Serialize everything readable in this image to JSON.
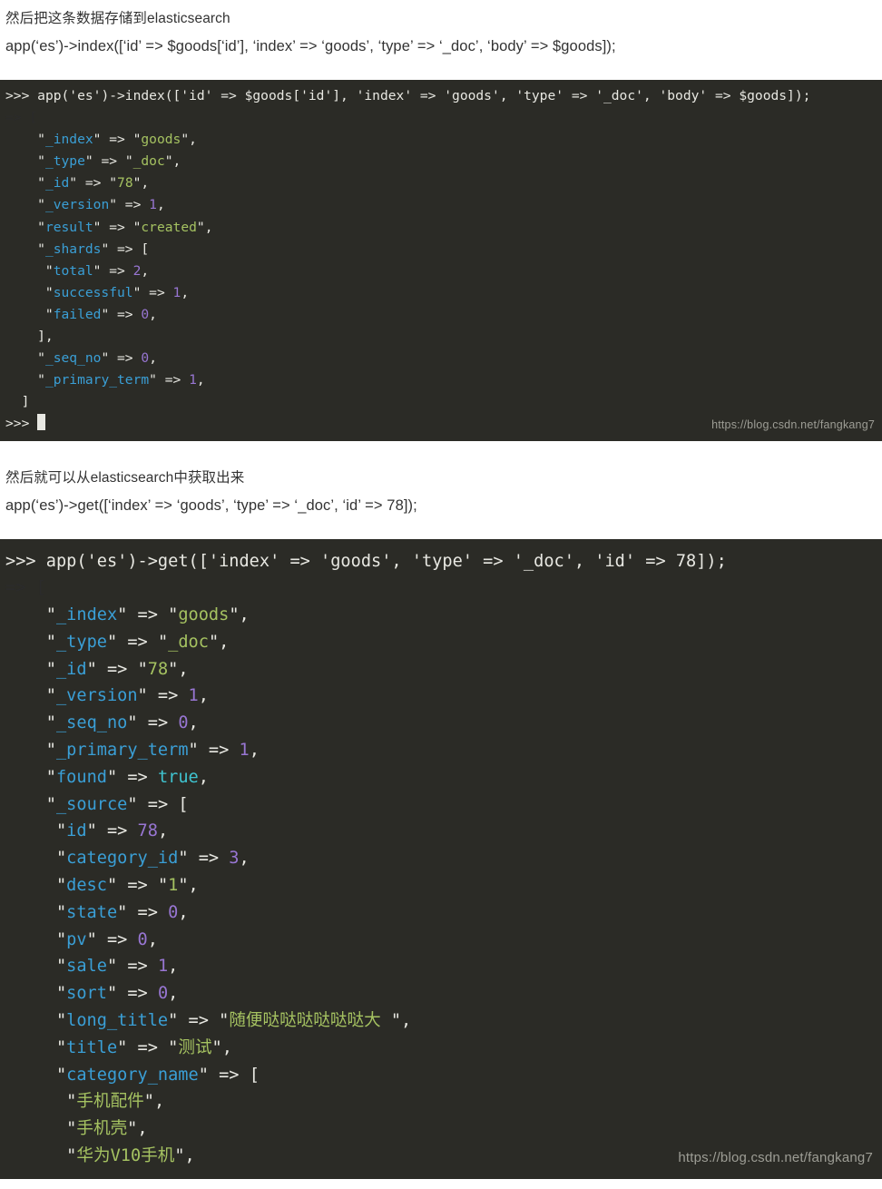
{
  "page": {
    "background": "#ffffff",
    "terminal_background": "#2b2b26"
  },
  "colors": {
    "key": "#3a9fd6",
    "string": "#a5c261",
    "number": "#9876d3",
    "boolean": "#3fc4d0",
    "plain": "#e8e8e2",
    "watermark": "#9d9d95"
  },
  "intro_section": {
    "note": "然后把这条数据存储到elasticsearch",
    "code": "app(‘es’)->index([‘id’ => $goods[‘id’], ‘index’ => ‘goods’, ‘type’ => ‘_doc’, ‘body’ => $goods]);"
  },
  "terminal_one": {
    "watermark": "https://blog.csdn.net/fangkang7",
    "prompt": ">>>",
    "command": "app('es')->index(['id' => $goods['id'], 'index' => 'goods', 'type' => '_doc', 'body' => $goods]);",
    "result_open": "=> [",
    "entries": [
      {
        "indent": 4,
        "key": "_index",
        "value": "goods",
        "type": "string"
      },
      {
        "indent": 4,
        "key": "_type",
        "value": "_doc",
        "type": "string"
      },
      {
        "indent": 4,
        "key": "_id",
        "value": "78",
        "type": "string"
      },
      {
        "indent": 4,
        "key": "_version",
        "value": "1",
        "type": "number"
      },
      {
        "indent": 4,
        "key": "result",
        "value": "created",
        "type": "string"
      },
      {
        "indent": 4,
        "key": "_shards",
        "value": "[",
        "type": "open"
      },
      {
        "indent": 5,
        "key": "total",
        "value": "2",
        "type": "number"
      },
      {
        "indent": 5,
        "key": "successful",
        "value": "1",
        "type": "number"
      },
      {
        "indent": 5,
        "key": "failed",
        "value": "0",
        "type": "number"
      },
      {
        "indent": 4,
        "key": "",
        "value": "],",
        "type": "close"
      },
      {
        "indent": 4,
        "key": "_seq_no",
        "value": "0",
        "type": "number"
      },
      {
        "indent": 4,
        "key": "_primary_term",
        "value": "1",
        "type": "number"
      }
    ],
    "result_close": "  ]",
    "trailing_prompt": ">>>"
  },
  "middle_section": {
    "note": "然后就可以从elasticsearch中获取出来",
    "code": "app(‘es’)->get([‘index’ => ‘goods’, ‘type’ => ‘_doc’, ‘id’ => 78]);"
  },
  "terminal_two": {
    "watermark": "https://blog.csdn.net/fangkang7",
    "prompt": ">>>",
    "command": "app('es')->get(['index' => 'goods', 'type' => '_doc', 'id' => 78]);",
    "result_open": "=> [",
    "entries": [
      {
        "indent": 4,
        "key": "_index",
        "value": "goods",
        "type": "string"
      },
      {
        "indent": 4,
        "key": "_type",
        "value": "_doc",
        "type": "string"
      },
      {
        "indent": 4,
        "key": "_id",
        "value": "78",
        "type": "string"
      },
      {
        "indent": 4,
        "key": "_version",
        "value": "1",
        "type": "number"
      },
      {
        "indent": 4,
        "key": "_seq_no",
        "value": "0",
        "type": "number"
      },
      {
        "indent": 4,
        "key": "_primary_term",
        "value": "1",
        "type": "number"
      },
      {
        "indent": 4,
        "key": "found",
        "value": "true",
        "type": "boolean"
      },
      {
        "indent": 4,
        "key": "_source",
        "value": "[",
        "type": "open"
      },
      {
        "indent": 5,
        "key": "id",
        "value": "78",
        "type": "number"
      },
      {
        "indent": 5,
        "key": "category_id",
        "value": "3",
        "type": "number"
      },
      {
        "indent": 5,
        "key": "desc",
        "value": "1",
        "type": "string"
      },
      {
        "indent": 5,
        "key": "state",
        "value": "0",
        "type": "number"
      },
      {
        "indent": 5,
        "key": "pv",
        "value": "0",
        "type": "number"
      },
      {
        "indent": 5,
        "key": "sale",
        "value": "1",
        "type": "number"
      },
      {
        "indent": 5,
        "key": "sort",
        "value": "0",
        "type": "number"
      },
      {
        "indent": 5,
        "key": "long_title",
        "value": "随便哒哒哒哒哒哒大 ",
        "type": "string"
      },
      {
        "indent": 5,
        "key": "title",
        "value": "测试",
        "type": "string"
      },
      {
        "indent": 5,
        "key": "category_name",
        "value": "[",
        "type": "open"
      },
      {
        "indent": 6,
        "key": "",
        "value": "手机配件",
        "type": "bare-string"
      },
      {
        "indent": 6,
        "key": "",
        "value": "手机壳",
        "type": "bare-string"
      },
      {
        "indent": 6,
        "key": "",
        "value": "华为V10手机",
        "type": "bare-string"
      }
    ]
  }
}
